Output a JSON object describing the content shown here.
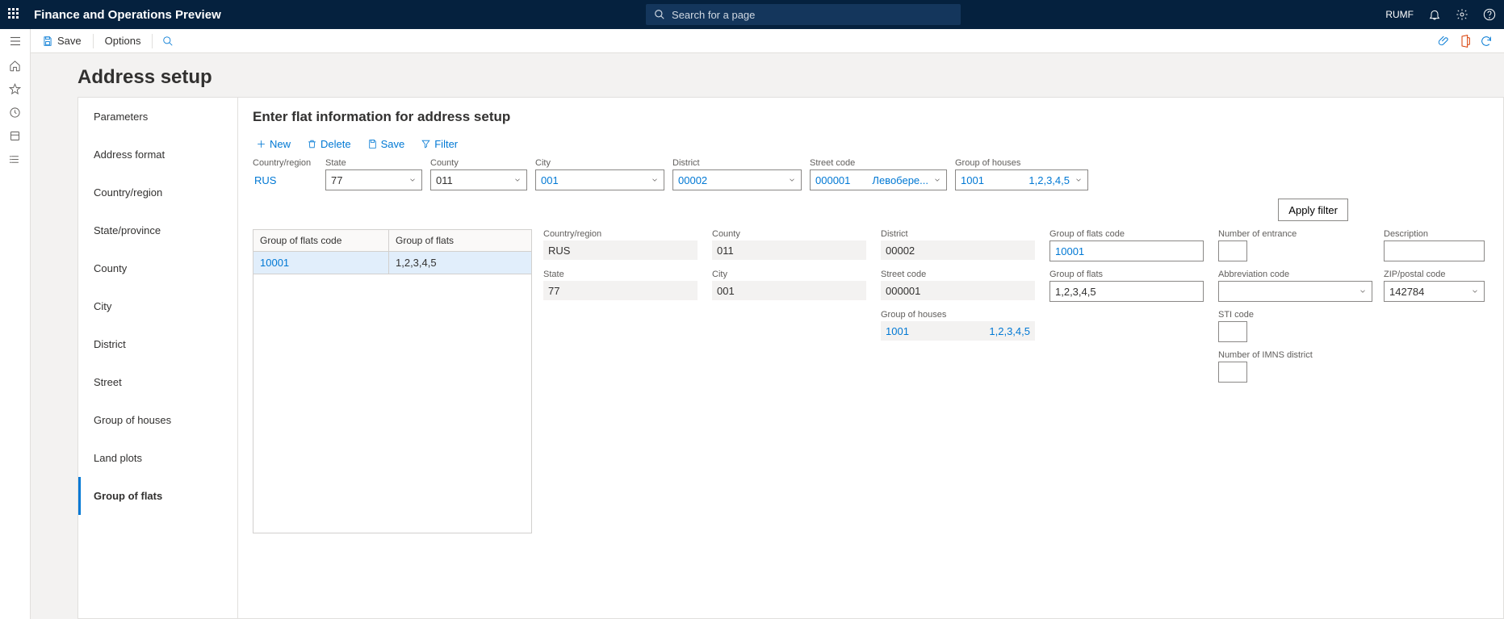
{
  "topbar": {
    "title": "Finance and Operations Preview",
    "search_placeholder": "Search for a page",
    "legal_entity": "RUMF"
  },
  "cmdbar": {
    "save": "Save",
    "options": "Options"
  },
  "page_title": "Address setup",
  "sidenav": [
    "Parameters",
    "Address format",
    "Country/region",
    "State/province",
    "County",
    "City",
    "District",
    "Street",
    "Group of houses",
    "Land plots",
    "Group of flats"
  ],
  "content": {
    "title": "Enter flat information for address setup",
    "toolbar": {
      "new": "New",
      "delete": "Delete",
      "save": "Save",
      "filter": "Filter"
    },
    "filters": {
      "country_label": "Country/region",
      "country_value": "RUS",
      "state_label": "State",
      "state_value": "77",
      "county_label": "County",
      "county_value": "011",
      "city_label": "City",
      "city_value": "001",
      "district_label": "District",
      "district_value": "00002",
      "street_label": "Street code",
      "street_value": "000001",
      "street_name": "Левобере...",
      "houses_label": "Group of houses",
      "houses_value": "1001",
      "houses_list": "1,2,3,4,5",
      "apply": "Apply filter"
    },
    "grid": {
      "col1": "Group of flats code",
      "col2": "Group of flats",
      "rows": [
        {
          "code": "10001",
          "flats": "1,2,3,4,5"
        }
      ]
    },
    "details": {
      "country_label": "Country/region",
      "country_value": "RUS",
      "county_label": "County",
      "county_value": "011",
      "district_label": "District",
      "district_value": "00002",
      "flats_code_label": "Group of flats code",
      "flats_code_value": "10001",
      "entrance_label": "Number of entrance",
      "entrance_value": "",
      "desc_label": "Description",
      "desc_value": "",
      "state_label": "State",
      "state_value": "77",
      "city_label": "City",
      "city_value": "001",
      "street_label": "Street code",
      "street_value": "000001",
      "flats_label": "Group of flats",
      "flats_value": "1,2,3,4,5",
      "abbr_label": "Abbreviation code",
      "abbr_value": "",
      "zip_label": "ZIP/postal code",
      "zip_value": "142784",
      "houses_label": "Group of houses",
      "houses_value": "1001",
      "houses_list": "1,2,3,4,5",
      "sti_label": "STI code",
      "sti_value": "",
      "imns_label": "Number of IMNS district",
      "imns_value": ""
    }
  }
}
